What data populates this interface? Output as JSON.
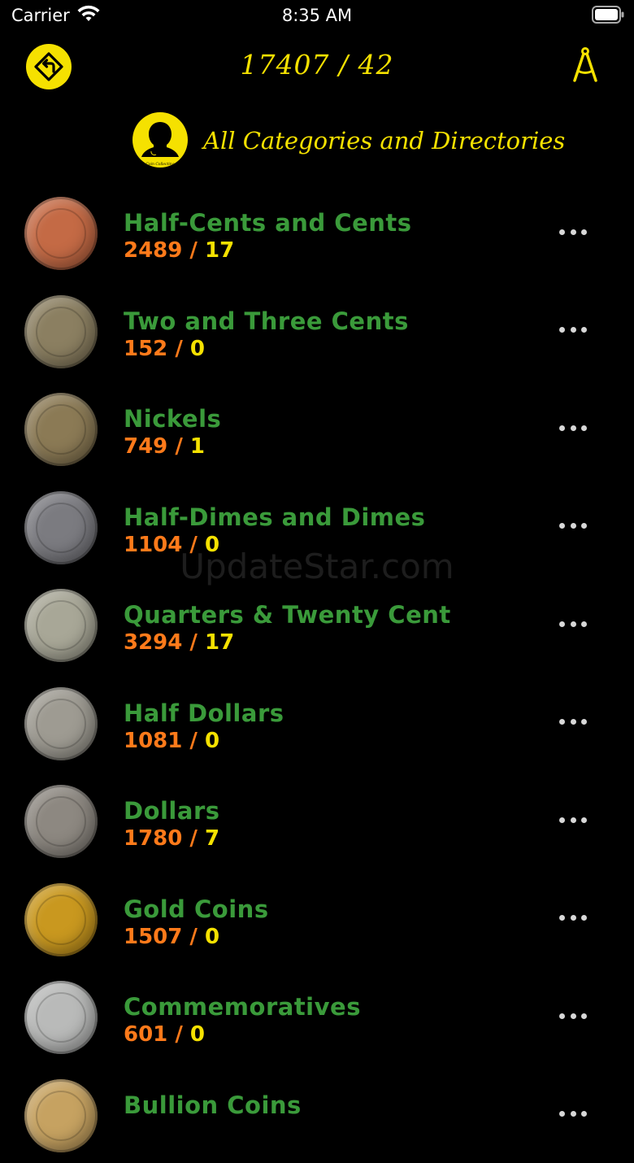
{
  "status_bar": {
    "carrier": "Carrier",
    "time": "8:35 AM"
  },
  "nav": {
    "title": "17407 / 42"
  },
  "header": {
    "title": "All Categories and Directories",
    "avatar_caption": "Coin Collecting"
  },
  "watermark": "UpdateStar.com",
  "colors": {
    "accent": "#f5e100",
    "title_green": "#3a9a3a",
    "count_orange": "#ff7a1a",
    "background": "#000000"
  },
  "categories": [
    {
      "label": "Half-Cents and Cents",
      "count_total": "2489",
      "count_sub": "17",
      "coin_color": "#c46a45"
    },
    {
      "label": "Two and Three Cents",
      "count_total": "152",
      "count_sub": "0",
      "coin_color": "#8b7f61"
    },
    {
      "label": "Nickels",
      "count_total": "749",
      "count_sub": "1",
      "coin_color": "#8b7a55"
    },
    {
      "label": "Half-Dimes and Dimes",
      "count_total": "1104",
      "count_sub": "0",
      "coin_color": "#7b7b80"
    },
    {
      "label": "Quarters & Twenty Cent",
      "count_total": "3294",
      "count_sub": "17",
      "coin_color": "#a8a797"
    },
    {
      "label": "Half Dollars",
      "count_total": "1081",
      "count_sub": "0",
      "coin_color": "#9e9b92"
    },
    {
      "label": "Dollars",
      "count_total": "1780",
      "count_sub": "7",
      "coin_color": "#8d8881"
    },
    {
      "label": "Gold Coins",
      "count_total": "1507",
      "count_sub": "0",
      "coin_color": "#c9981f"
    },
    {
      "label": "Commemoratives",
      "count_total": "601",
      "count_sub": "0",
      "coin_color": "#b9bab9"
    },
    {
      "label": "Bullion Coins",
      "count_total": "",
      "count_sub": "",
      "coin_color": "#c6a261"
    }
  ]
}
